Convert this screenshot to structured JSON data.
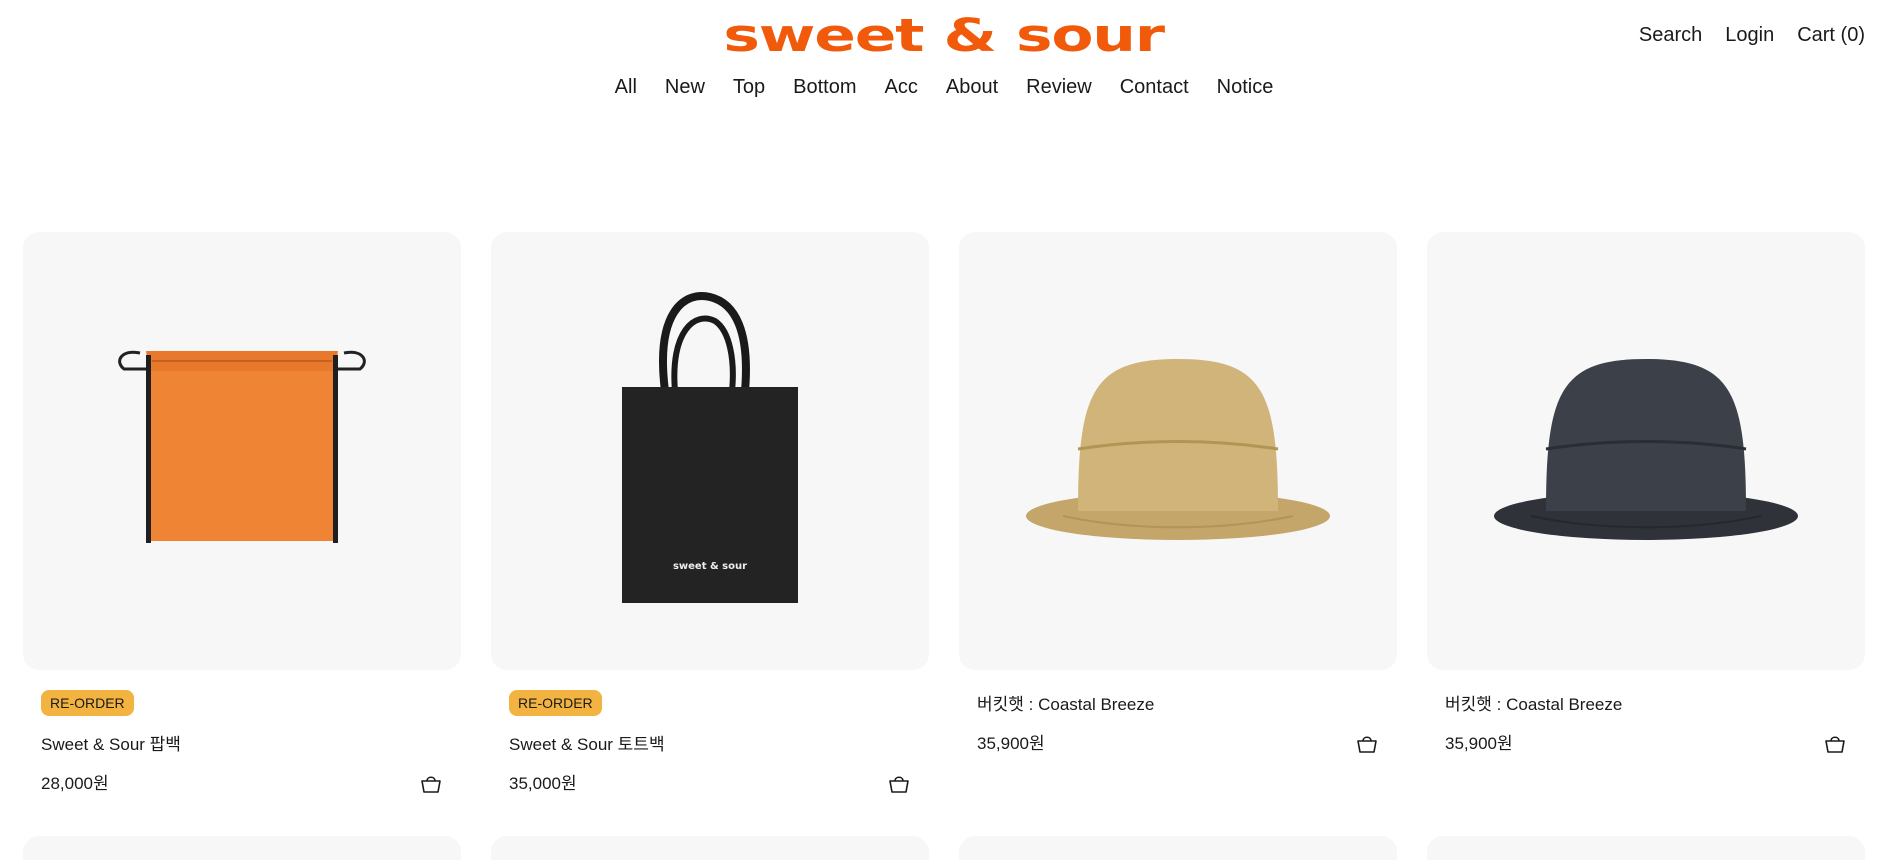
{
  "header": {
    "logo_text": "sweet & sour",
    "utility": {
      "search": "Search",
      "login": "Login",
      "cart": "Cart (0)"
    },
    "nav": [
      "All",
      "New",
      "Top",
      "Bottom",
      "Acc",
      "About",
      "Review",
      "Contact",
      "Notice"
    ]
  },
  "colors": {
    "brand": "#f05a0a",
    "badge": "#f2b340",
    "card_bg": "#f7f7f7"
  },
  "products": [
    {
      "badge": "RE-ORDER",
      "name": "Sweet & Sour 팝백",
      "price": "28,000원",
      "image": "orange-drawstring-bag"
    },
    {
      "badge": "RE-ORDER",
      "name": "Sweet & Sour 토트백",
      "price": "35,000원",
      "image": "black-tote-bag",
      "print": "sweet & sour"
    },
    {
      "badge": "",
      "name": "버킷햇 : Coastal Breeze",
      "price": "35,900원",
      "image": "beige-bucket-hat"
    },
    {
      "badge": "",
      "name": "버킷햇 : Coastal Breeze",
      "price": "35,900원",
      "image": "charcoal-bucket-hat"
    }
  ]
}
